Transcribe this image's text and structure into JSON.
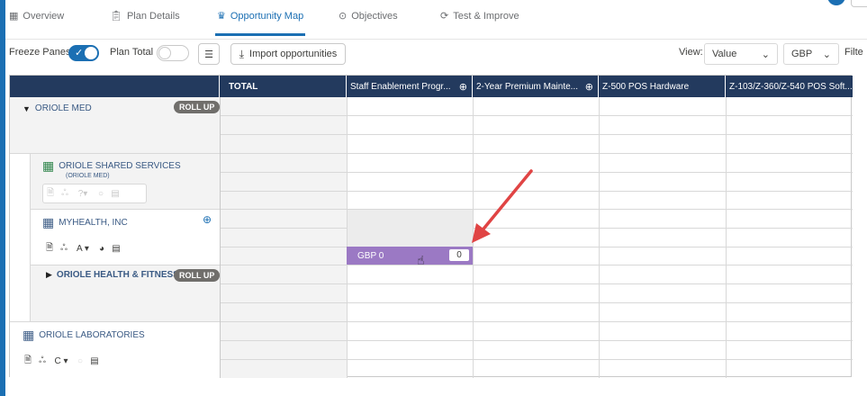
{
  "tabs": [
    {
      "label": "Overview",
      "icon": "grid-icon"
    },
    {
      "label": "Plan Details",
      "icon": "clipboard-icon"
    },
    {
      "label": "Opportunity Map",
      "icon": "crown-icon",
      "active": true
    },
    {
      "label": "Objectives",
      "icon": "target-icon"
    },
    {
      "label": "Test & Improve",
      "icon": "refresh-icon"
    }
  ],
  "toolbar": {
    "freeze_panes": "Freeze Panes",
    "plan_total": "Plan Total",
    "import_label": "Import opportunities",
    "view_label": "View:",
    "view_value": "Value",
    "currency_value": "GBP",
    "filter_label": "Filte"
  },
  "grid": {
    "total_header": "TOTAL",
    "columns": [
      "Staff Enablement Progr...",
      "2-Year Premium Mainte...",
      "Z-500 POS Hardware",
      "Z-103/Z-360/Z-540 POS Soft..."
    ],
    "accounts": {
      "oriole_med": "ORIOLE MED",
      "roll_up": "ROLL UP",
      "shared_services": "ORIOLE SHARED SERVICES",
      "shared_services_parent": "(ORIOLE MED)",
      "myhealth": "MYHEALTH, INC",
      "myhealth_level": "A",
      "health_fitness": "ORIOLE HEALTH & FITNESS",
      "laboratories": "ORIOLE LABORATORIES",
      "laboratories_level": "C",
      "shared_level": "?"
    },
    "cell": {
      "currency_value": "GBP 0",
      "input_value": "0"
    }
  },
  "colors": {
    "accent": "#1b6fb3",
    "header_bg": "#233a5e",
    "cell_highlight": "#9b79c4",
    "arrow": "#e04444"
  }
}
